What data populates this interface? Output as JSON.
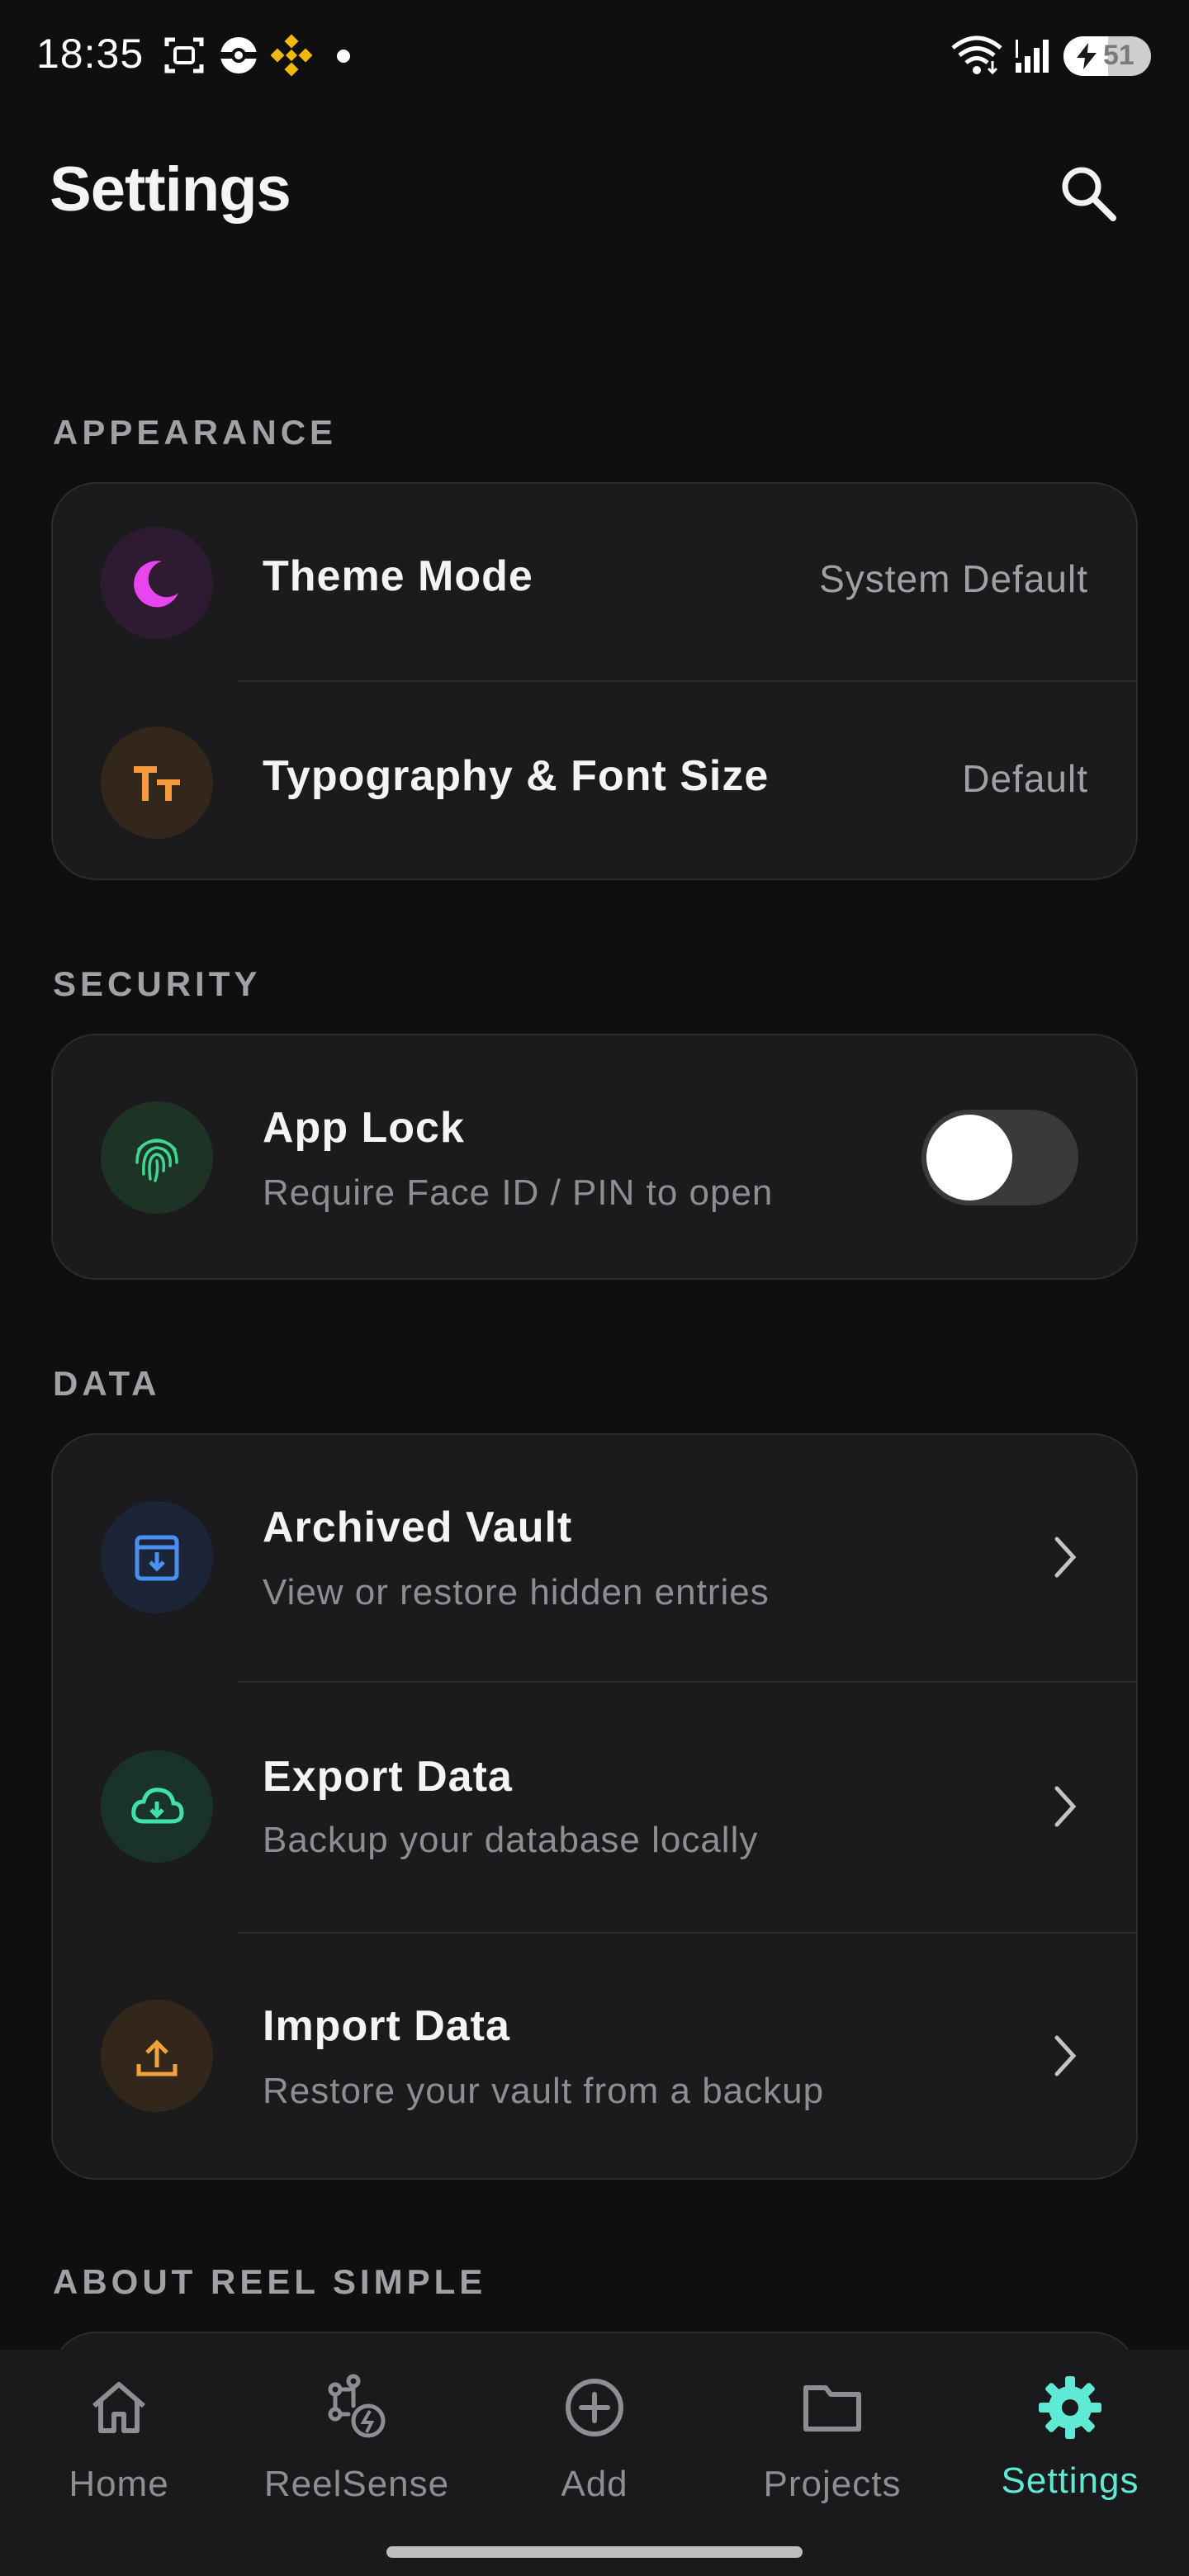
{
  "status_bar": {
    "time": "18:35",
    "battery_percent": "51",
    "battery_level": 0.51,
    "icons": [
      "screenshot-icon",
      "pokeball-icon",
      "binance-icon",
      "notification-dot",
      "wifi-icon",
      "signal-icon",
      "battery-charging-icon"
    ]
  },
  "header": {
    "title": "Settings",
    "search_icon": "search-icon"
  },
  "sections": {
    "appearance": {
      "label": "APPEARANCE",
      "rows": [
        {
          "title": "Theme Mode",
          "value": "System Default",
          "icon": "moon-icon",
          "icon_color": "#e845f0",
          "icon_bg": "#2e1a31"
        },
        {
          "title": "Typography & Font Size",
          "value": "Default",
          "icon": "text-size-icon",
          "icon_color": "#f59a3d",
          "icon_bg": "#33261a"
        }
      ]
    },
    "security": {
      "label": "SECURITY",
      "rows": [
        {
          "title": "App Lock",
          "subtitle": "Require Face ID / PIN to open",
          "icon": "fingerprint-icon",
          "icon_color": "#3fd68f",
          "icon_bg": "#1c3326",
          "toggle_on": false
        }
      ]
    },
    "data": {
      "label": "DATA",
      "rows": [
        {
          "title": "Archived Vault",
          "subtitle": "View or restore hidden entries",
          "icon": "archive-icon",
          "icon_color": "#4a90f2",
          "icon_bg": "#1b2537"
        },
        {
          "title": "Export Data",
          "subtitle": "Backup your database locally",
          "icon": "cloud-download-icon",
          "icon_color": "#3fe0b0",
          "icon_bg": "#1a3329"
        },
        {
          "title": "Import Data",
          "subtitle": "Restore your vault from a backup",
          "icon": "upload-icon",
          "icon_color": "#f5a23d",
          "icon_bg": "#33261a"
        }
      ]
    },
    "about": {
      "label": "ABOUT REEL SIMPLE"
    }
  },
  "bottom_nav": {
    "items": [
      {
        "label": "Home",
        "icon": "home-icon",
        "active": false
      },
      {
        "label": "ReelSense",
        "icon": "ai-sparkle-icon",
        "active": false
      },
      {
        "label": "Add",
        "icon": "add-circle-icon",
        "active": false
      },
      {
        "label": "Projects",
        "icon": "folder-icon",
        "active": false
      },
      {
        "label": "Settings",
        "icon": "gear-icon",
        "active": true
      }
    ]
  },
  "colors": {
    "background": "#0f0f10",
    "card": "#1b1b1d",
    "accent": "#5eead4",
    "text_primary": "#f4f4f4",
    "text_secondary": "#8d8d93"
  }
}
